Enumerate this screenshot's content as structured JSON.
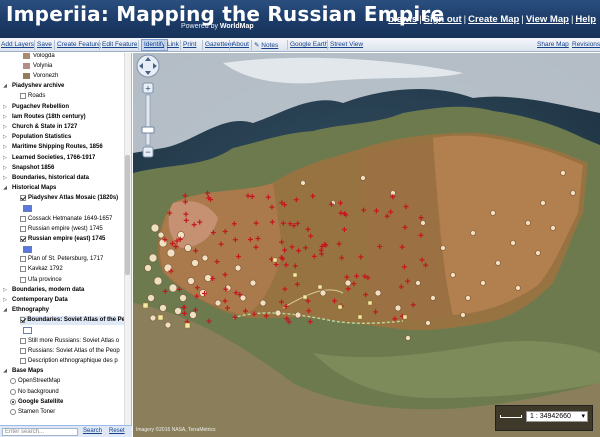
{
  "header": {
    "title": "Imperiia: Mapping the Russian Empire",
    "powered_prefix": "Powered by ",
    "powered_brand": "WorldMap",
    "links": [
      "blewis",
      "Sign out",
      "Create Map",
      "View Map",
      "Help"
    ]
  },
  "toolbar": {
    "items": [
      "Add Layers",
      "Save",
      "Create Feature",
      "Edit Feature",
      "Identify",
      "Link",
      "Print",
      "Gazetteer",
      "About",
      "Notes",
      "Google Earth",
      "Street View"
    ],
    "right_items": [
      "Share Map",
      "Revisions"
    ],
    "active": "Identify"
  },
  "sidebar": {
    "rows": [
      {
        "type": "swatch",
        "label": "Vologda",
        "color": "#a98a73"
      },
      {
        "type": "swatch",
        "label": "Volynia",
        "color": "#b58c86"
      },
      {
        "type": "swatch",
        "label": "Voronezh",
        "color": "#9a7a5f"
      },
      {
        "type": "group",
        "label": "Piadyshev archive",
        "open": true
      },
      {
        "type": "layer",
        "label": "Roads",
        "checked": false
      },
      {
        "type": "group",
        "label": "Pugachev Rebellion",
        "open": false
      },
      {
        "type": "group",
        "label": "Iam Routes (18th century)",
        "open": false
      },
      {
        "type": "group",
        "label": "Church & State in 1727",
        "open": false
      },
      {
        "type": "group",
        "label": "Population Statistics",
        "open": false
      },
      {
        "type": "group",
        "label": "Maritime Shipping Routes, 1856",
        "open": false
      },
      {
        "type": "group",
        "label": "Learned Societies, 1766-1917",
        "open": false
      },
      {
        "type": "group",
        "label": "Snapshot 1856",
        "open": false
      },
      {
        "type": "group",
        "label": "Boundaries, historical data",
        "open": false
      },
      {
        "type": "group",
        "label": "Historical Maps",
        "open": true
      },
      {
        "type": "layer",
        "label": "Piadyshev Atlas Mosaic (1820s)",
        "checked": true,
        "bold": true
      },
      {
        "type": "legend",
        "color": "#5b78e0"
      },
      {
        "type": "layer",
        "label": "Cossack Hetmanate 1649-1657",
        "checked": false
      },
      {
        "type": "layer",
        "label": "Russian empire (west) 1745",
        "checked": false
      },
      {
        "type": "layer",
        "label": "Russian empire (east) 1745",
        "checked": true,
        "bold": true
      },
      {
        "type": "legend",
        "color": "#5b78e0"
      },
      {
        "type": "layer",
        "label": "Plan of St. Petersburg, 1717",
        "checked": false
      },
      {
        "type": "layer",
        "label": "Kavkaz 1792",
        "checked": false
      },
      {
        "type": "layer",
        "label": "Ufa province",
        "checked": false
      },
      {
        "type": "group",
        "label": "Boundaries, modern data",
        "open": false
      },
      {
        "type": "group",
        "label": "Contemporary Data",
        "open": false
      },
      {
        "type": "group",
        "label": "Ethnography",
        "open": true
      },
      {
        "type": "layer",
        "label": "Boundaries: Soviet Atlas of the Pe",
        "checked": true,
        "bold": true,
        "highlight": true
      },
      {
        "type": "legend",
        "color": "#ffffff"
      },
      {
        "type": "layer",
        "label": "Still more Russians: Soviet Atlas o",
        "checked": false
      },
      {
        "type": "layer",
        "label": "Russians: Soviet Atlas of the Peop",
        "checked": false
      },
      {
        "type": "layer",
        "label": "Description ethnographique des p",
        "checked": false
      },
      {
        "type": "group",
        "label": "Base Maps",
        "open": true
      },
      {
        "type": "radio",
        "label": "OpenStreetMap",
        "on": false
      },
      {
        "type": "radio",
        "label": "No background",
        "on": false
      },
      {
        "type": "radio",
        "label": "Google Satellite",
        "on": true,
        "bold": true
      },
      {
        "type": "radio",
        "label": "Stamen Toner",
        "on": false
      }
    ]
  },
  "bottom": {
    "search_placeholder": "Enter search...",
    "search_label": "Search",
    "reset_label": "Reset"
  },
  "map": {
    "scale_value": "1 : 34942660",
    "attribution": "Imagery ©2016 NASA, TerraMetrics"
  }
}
